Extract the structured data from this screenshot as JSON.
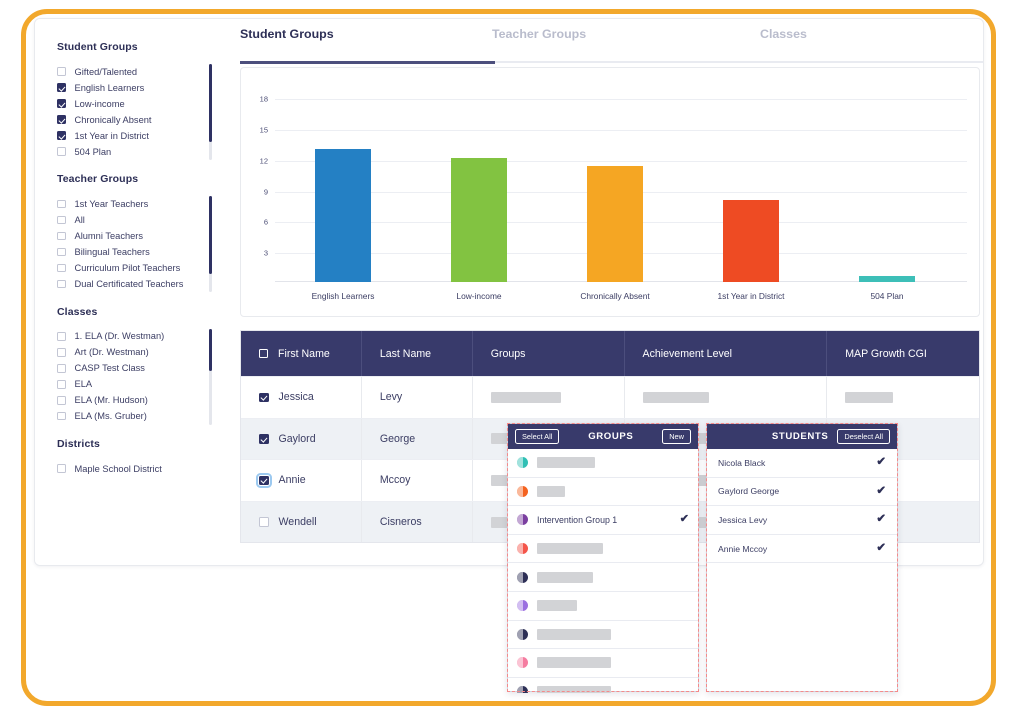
{
  "theme": {
    "frame_color": "#F2A82C",
    "header_navy": "#383a6b",
    "text_navy": "#3b3d63",
    "muted_tab": "#b9bccc",
    "row_alt": "#eef1f5",
    "dashed_highlight": "#f58a8a"
  },
  "tabs": [
    {
      "label": "Student Groups",
      "active": true
    },
    {
      "label": "Teacher Groups",
      "active": false
    },
    {
      "label": "Classes",
      "active": false
    }
  ],
  "sidebar": {
    "sections": [
      {
        "title": "Student Groups",
        "items": [
          {
            "label": "Gifted/Talented",
            "checked": false
          },
          {
            "label": "English Learners",
            "checked": true
          },
          {
            "label": "Low-income",
            "checked": true
          },
          {
            "label": "Chronically Absent",
            "checked": true
          },
          {
            "label": "1st Year in District",
            "checked": true
          },
          {
            "label": "504 Plan",
            "checked": false
          }
        ]
      },
      {
        "title": "Teacher Groups",
        "items": [
          {
            "label": "1st Year Teachers",
            "checked": false
          },
          {
            "label": "All",
            "checked": false
          },
          {
            "label": "Alumni Teachers",
            "checked": false
          },
          {
            "label": "Bilingual Teachers",
            "checked": false
          },
          {
            "label": "Curriculum Pilot Teachers",
            "checked": false
          },
          {
            "label": "Dual Certificated Teachers",
            "checked": false
          }
        ]
      },
      {
        "title": "Classes",
        "items": [
          {
            "label": "1. ELA (Dr. Westman)",
            "checked": false
          },
          {
            "label": "Art (Dr. Westman)",
            "checked": false
          },
          {
            "label": "CASP Test Class",
            "checked": false
          },
          {
            "label": "ELA",
            "checked": false
          },
          {
            "label": "ELA (Mr. Hudson)",
            "checked": false
          },
          {
            "label": "ELA (Ms. Gruber)",
            "checked": false
          }
        ]
      },
      {
        "title": "Districts",
        "items": [
          {
            "label": "Maple School District",
            "checked": false
          }
        ]
      }
    ]
  },
  "chart_data": {
    "type": "bar",
    "title": "",
    "xlabel": "",
    "ylabel": "",
    "ylim": [
      0,
      19.5
    ],
    "grid": true,
    "legend": "none",
    "yticks": [
      3,
      6,
      9,
      12,
      15,
      18
    ],
    "categories": [
      "English Learners",
      "Low-income",
      "Chronically Absent",
      "1st Year in District",
      "504 Plan"
    ],
    "values": [
      13.0,
      12.1,
      11.3,
      8.0,
      0.6
    ],
    "colors": [
      "#2480c4",
      "#82c341",
      "#f5a623",
      "#ee4b23",
      "#3dbfb8"
    ]
  },
  "table": {
    "columns": [
      "First Name",
      "Last Name",
      "Groups",
      "Achievement Level",
      "MAP Growth CGI"
    ],
    "header_checkbox_checked": false,
    "rows": [
      {
        "checked": true,
        "focused": false,
        "first_name": "Jessica",
        "last_name": "Levy",
        "groups": "",
        "achievement": "",
        "map_growth": ""
      },
      {
        "checked": true,
        "focused": false,
        "first_name": "Gaylord",
        "last_name": "George",
        "groups": "",
        "achievement": "",
        "map_growth": ""
      },
      {
        "checked": true,
        "focused": true,
        "first_name": "Annie",
        "last_name": "Mccoy",
        "groups": "",
        "achievement": "",
        "map_growth": ""
      },
      {
        "checked": false,
        "focused": false,
        "first_name": "Wendell",
        "last_name": "Cisneros",
        "groups": "",
        "achievement": "",
        "map_growth": ""
      }
    ]
  },
  "groups_popup": {
    "title": "GROUPS",
    "select_all_label": "Select All",
    "new_label": "New",
    "rows": [
      {
        "name": "",
        "color": "#2fbfb4",
        "checked": false,
        "redacted_width": 58
      },
      {
        "name": "",
        "color": "#f4621f",
        "checked": false,
        "redacted_width": 28
      },
      {
        "name": "Intervention Group 1",
        "color": "#7b3fa0",
        "checked": true,
        "redacted_width": 0
      },
      {
        "name": "",
        "color": "#f4554a",
        "checked": false,
        "redacted_width": 66
      },
      {
        "name": "",
        "color": "#2d2f56",
        "checked": false,
        "redacted_width": 56
      },
      {
        "name": "",
        "color": "#9b6fe0",
        "checked": false,
        "redacted_width": 40
      },
      {
        "name": "",
        "color": "#2d2f56",
        "checked": false,
        "redacted_width": 74
      },
      {
        "name": "",
        "color": "#f57ca0",
        "checked": false,
        "redacted_width": 74
      },
      {
        "name": "",
        "color": "#2d2f56",
        "checked": false,
        "redacted_width": 74
      }
    ]
  },
  "students_popup": {
    "title": "STUDENTS",
    "deselect_all_label": "Deselect All",
    "rows": [
      {
        "name": "Nicola Black",
        "checked": true
      },
      {
        "name": "Gaylord George",
        "checked": true
      },
      {
        "name": "Jessica Levy",
        "checked": true
      },
      {
        "name": "Annie Mccoy",
        "checked": true
      }
    ]
  },
  "icons": {
    "check": "✔",
    "group_swatch": "group-color-swatch"
  }
}
